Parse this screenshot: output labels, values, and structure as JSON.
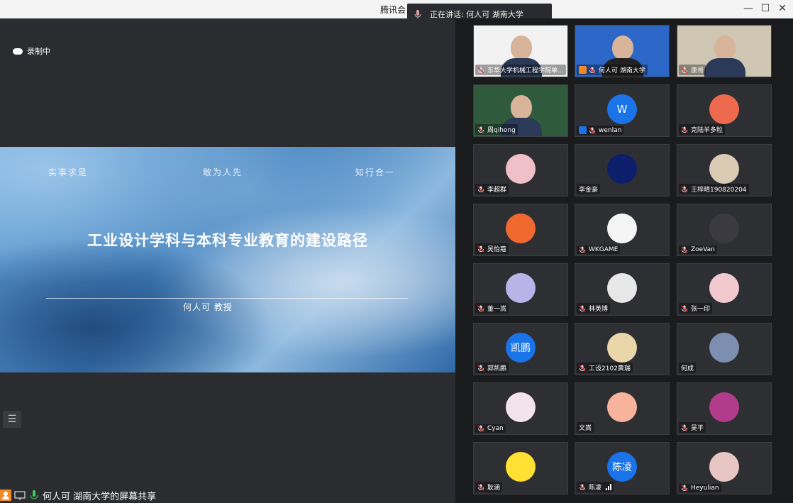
{
  "window": {
    "app_title": "腾讯会",
    "speaking_label": "正在讲话: 何人可 湖南大学"
  },
  "stage": {
    "recording_label": "录制中",
    "slide": {
      "mottos": [
        "实事求是",
        "敢为人先",
        "知行合一"
      ],
      "title": "工业设计学科与本科专业教育的建设路径",
      "presenter": "何人可    教授"
    },
    "share_label": "何人可 湖南大学的屏幕共享"
  },
  "participants": [
    {
      "name": "东华大学机械工程学院单...",
      "type": "video"
    },
    {
      "name": "何人可 湖南大学",
      "type": "video",
      "badge": true
    },
    {
      "name": "唐哥",
      "type": "video"
    },
    {
      "name": "周qihong",
      "type": "video"
    },
    {
      "name": "wenlan",
      "type": "avatar",
      "initial": "W",
      "color": "#1a73e8",
      "badge": true
    },
    {
      "name": "克陆羊多粒",
      "type": "avatar",
      "color": "#ee6a4e"
    },
    {
      "name": "李超群",
      "type": "avatar",
      "color": "#f0c0c8"
    },
    {
      "name": "李金豪",
      "type": "avatar",
      "color": "#0d1f6b",
      "no_mic": true
    },
    {
      "name": "王梓晴190820204",
      "type": "avatar",
      "color": "#d9cbb4"
    },
    {
      "name": "吴怡蔻",
      "type": "avatar",
      "color": "#f06a30"
    },
    {
      "name": "WKGAME",
      "type": "avatar",
      "color": "#f5f5f5"
    },
    {
      "name": "ZoeVan",
      "type": "avatar",
      "color": "#3a3a40"
    },
    {
      "name": "董一嵩",
      "type": "avatar",
      "color": "#b9b3e8"
    },
    {
      "name": "林英博",
      "type": "avatar",
      "color": "#e8e8e8"
    },
    {
      "name": "张一印",
      "type": "avatar",
      "color": "#f1c9cf"
    },
    {
      "name": "郭凯鹏",
      "type": "avatar",
      "initial": "凯鹏",
      "color": "#1a73e8"
    },
    {
      "name": "工设2102黄瑞",
      "type": "avatar",
      "color": "#e9d6a9"
    },
    {
      "name": "何成",
      "type": "avatar",
      "color": "#7c8fb0",
      "no_mic": true
    },
    {
      "name": "Cyan",
      "type": "avatar",
      "color": "#f3e3ea"
    },
    {
      "name": "文嵩",
      "type": "avatar",
      "color": "#f7b39b",
      "no_mic": true
    },
    {
      "name": "吴平",
      "type": "avatar",
      "color": "#b23c8c"
    },
    {
      "name": "耿涵",
      "type": "avatar",
      "color": "#ffe033"
    },
    {
      "name": "陈凌",
      "type": "avatar",
      "initial": "陈凌",
      "color": "#1a73e8",
      "signal": true
    },
    {
      "name": "Heyulian",
      "type": "avatar",
      "color": "#e8c6c4"
    }
  ]
}
